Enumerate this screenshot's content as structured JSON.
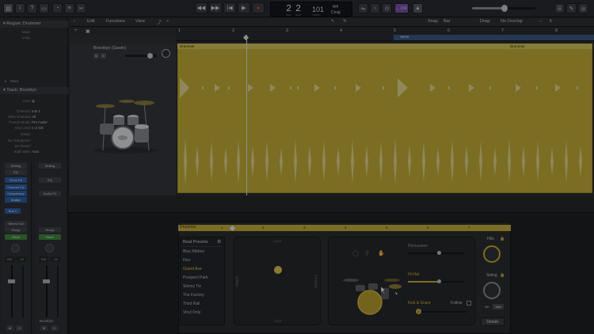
{
  "top_bar": {
    "transport": [
      "◀◀",
      "▶▶",
      "|◀",
      "▶",
      "●"
    ],
    "lcd": {
      "bar": "2",
      "beat": "2",
      "bar_label": "BAR",
      "beat_label": "BEAT",
      "tempo": "101",
      "tempo_label": "TEMPO",
      "time_sig": "4/4",
      "key": "Cmaj"
    },
    "count_in": "♩234"
  },
  "inspector": {
    "region_header": "Region: Drummer",
    "region_rows": [
      {
        "label": "Mute:",
        "value": ""
      },
      {
        "label": "Loop:",
        "value": ""
      }
    ],
    "more_label": "More",
    "track_header": "Track: Brooklyn",
    "track_rows": [
      {
        "label": "Icon:",
        "value": ""
      },
      {
        "label": "Channel:",
        "value": "Inst 1"
      },
      {
        "label": "MIDI Channel:",
        "value": "All"
      },
      {
        "label": "Freeze Mode:",
        "value": "Pre Fader"
      },
      {
        "label": "Key Limit:",
        "value": "C-2   G8"
      },
      {
        "label": "Delay:",
        "value": ""
      },
      {
        "label": "No Transpose:",
        "value": ""
      },
      {
        "label": "No Reset:",
        "value": ""
      },
      {
        "label": "Staff Style:",
        "value": "Auto"
      }
    ],
    "strip": {
      "setting": "Setting",
      "eq": "EQ",
      "drum_kit": "Drum Kit",
      "channel_eq": "Channel EQ",
      "compressor": "Compressor",
      "multipr": "Multipr",
      "audio_fx": "Audio FX",
      "bus": "Bus 1",
      "output": "Stereo Out",
      "group": "Group",
      "read": "Read",
      "vol_left": "0.0",
      "pan_left": "-16",
      "vol_right": "0.0",
      "pan_right": "-16",
      "name_right": "Brooklyn",
      "m": "M",
      "s": "S"
    }
  },
  "track_menu": {
    "edit": "Edit",
    "functions": "Functions",
    "view": "View",
    "snap_label": "Snap:",
    "snap_value": "Bar",
    "drag_label": "Drag:",
    "drag_value": "No Overlap"
  },
  "track_header": {
    "name": "Brooklyn (Gavin)",
    "mute": "M",
    "solo": "S"
  },
  "ruler": {
    "bars": [
      "1",
      "2",
      "3",
      "4",
      "5",
      "6",
      "7",
      "8"
    ],
    "section_marker": "Verse"
  },
  "region": {
    "title": "Drummer",
    "title_right": "Drummer"
  },
  "drummer_editor": {
    "title": "Drummer",
    "ruler_bars": [
      "1",
      "2",
      "3",
      "4",
      "5",
      "6",
      "7",
      "8"
    ],
    "presets_title": "Beat Presets",
    "presets": [
      {
        "label": "Blue Ribbon",
        "selected": false
      },
      {
        "label": "Flex",
        "selected": false
      },
      {
        "label": "Grand Ave",
        "selected": true
      },
      {
        "label": "Prospect Park",
        "selected": false
      },
      {
        "label": "Skinny Tie",
        "selected": false
      },
      {
        "label": "The Factory",
        "selected": false
      },
      {
        "label": "Third Rail",
        "selected": false
      },
      {
        "label": "Vinyl Only",
        "selected": false
      }
    ],
    "xy_pad": {
      "top": "Loud",
      "bottom": "Soft",
      "left": "Simple",
      "right": "Complex"
    },
    "kit": {
      "percussion": "Percussion",
      "hihat": "Hi-Hat",
      "kick_snare": "Kick & Snare",
      "follow": "Follow",
      "kick_number": "2"
    },
    "fills_label": "Fills",
    "swing_label": "Swing",
    "swing_8th": "8th",
    "swing_16th": "16th",
    "details": "Details"
  },
  "colors": {
    "region_gold": "#c6b037",
    "accent_blue": "#2d5fa8",
    "accent_green": "#3d8a3a"
  }
}
